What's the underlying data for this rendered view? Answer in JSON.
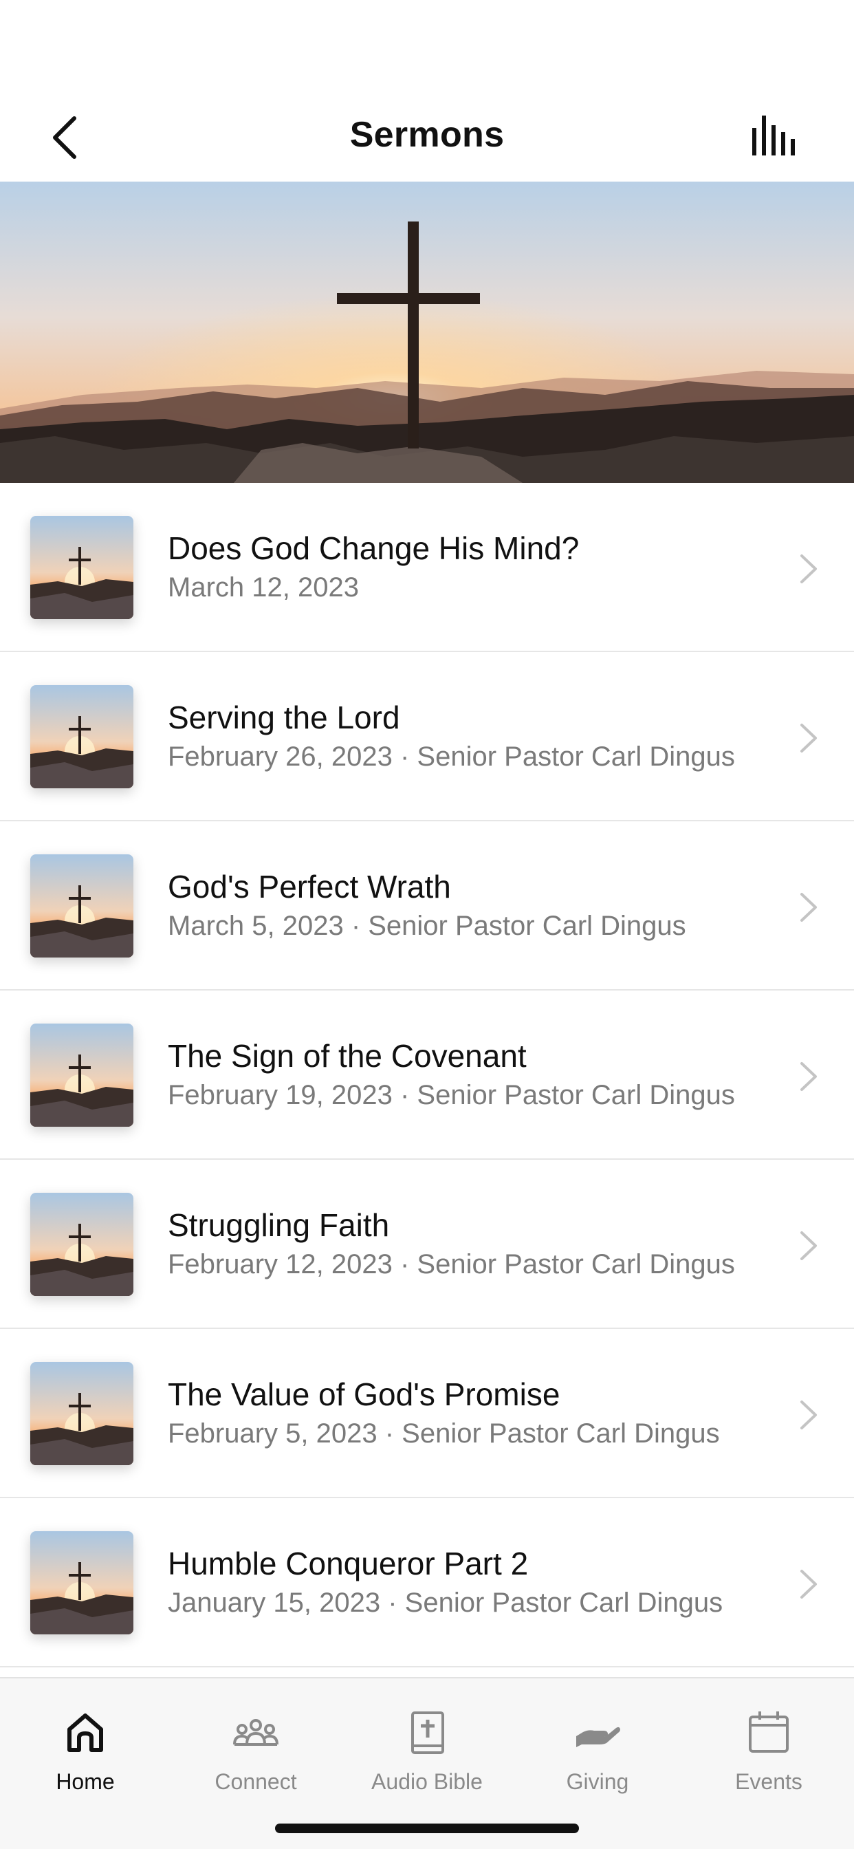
{
  "nav": {
    "title": "Sermons",
    "back_icon": "chevron-left-icon",
    "audio_icon": "audio-bars-icon"
  },
  "hero": {
    "description_icon": "cross-sunset-image"
  },
  "sermons": [
    {
      "title": "Does God Change His Mind?",
      "subtitle": "March 12, 2023"
    },
    {
      "title": "Serving the Lord",
      "subtitle": "February 26, 2023 · Senior Pastor Carl Dingus"
    },
    {
      "title": "God's Perfect Wrath",
      "subtitle": "March 5, 2023 · Senior Pastor Carl Dingus"
    },
    {
      "title": "The Sign of the Covenant",
      "subtitle": "February 19, 2023 · Senior Pastor Carl Dingus"
    },
    {
      "title": "Struggling Faith",
      "subtitle": "February 12, 2023 · Senior Pastor Carl Dingus"
    },
    {
      "title": "The Value of God's Promise",
      "subtitle": "February 5, 2023 · Senior Pastor Carl Dingus"
    },
    {
      "title": "Humble Conqueror Part 2",
      "subtitle": "January 15, 2023 · Senior Pastor Carl Dingus"
    }
  ],
  "tabs": [
    {
      "label": "Home",
      "icon": "home-icon",
      "active": true
    },
    {
      "label": "Connect",
      "icon": "people-icon",
      "active": false
    },
    {
      "label": "Audio Bible",
      "icon": "bible-icon",
      "active": false
    },
    {
      "label": "Giving",
      "icon": "giving-hand-icon",
      "active": false
    },
    {
      "label": "Events",
      "icon": "calendar-icon",
      "active": false
    }
  ],
  "colors": {
    "text_primary": "#111111",
    "text_secondary": "#7a7a7a",
    "tab_inactive": "#8a8a8a",
    "divider": "#e6e6e6"
  }
}
